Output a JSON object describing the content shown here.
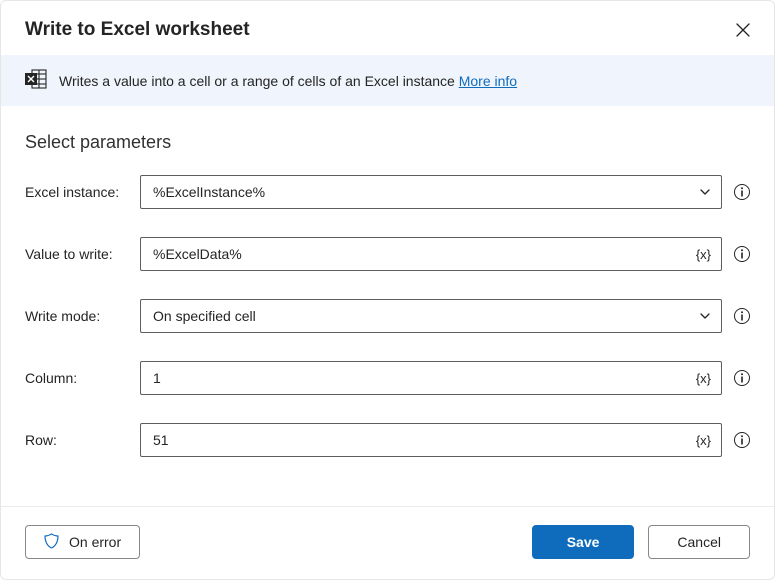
{
  "dialog": {
    "title": "Write to Excel worksheet"
  },
  "info": {
    "text": "Writes a value into a cell or a range of cells of an Excel instance ",
    "link": "More info"
  },
  "section_title": "Select parameters",
  "fields": {
    "excel_instance": {
      "label": "Excel instance:",
      "value": "%ExcelInstance%"
    },
    "value_to_write": {
      "label": "Value to write:",
      "value": "%ExcelData%"
    },
    "write_mode": {
      "label": "Write mode:",
      "value": "On specified cell"
    },
    "column": {
      "label": "Column:",
      "value": "1"
    },
    "row": {
      "label": "Row:",
      "value": "51"
    }
  },
  "footer": {
    "on_error": "On error",
    "save": "Save",
    "cancel": "Cancel"
  },
  "colors": {
    "accent": "#0f6cbd",
    "info_bg": "#f0f4fc"
  }
}
